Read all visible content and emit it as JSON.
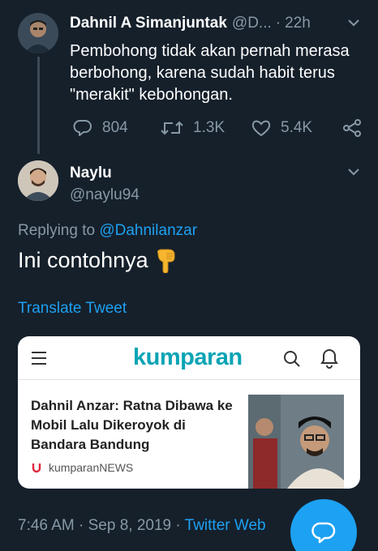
{
  "tweet1": {
    "name": "Dahnil A Simanjuntak",
    "handle": "@D...",
    "separator": "·",
    "time": "22h",
    "text": "Pembohong tidak akan pernah merasa berbohong, karena sudah habit terus \"merakit\" kebohongan.",
    "reply_count": "804",
    "retweet_count": "1.3K",
    "like_count": "5.4K"
  },
  "tweet2": {
    "name": "Naylu",
    "handle": "@naylu94",
    "replying_prefix": "Replying to ",
    "replying_to": "@Dahnilanzar",
    "text": "Ini contohnya",
    "translate": "Translate Tweet"
  },
  "card": {
    "logo": "kumparan",
    "headline": "Dahnil Anzar: Ratna Dibawa ke Mobil Lalu Dikeroyok di Bandara Bandung",
    "source": "kumparanNEWS"
  },
  "footer": {
    "time": "7:46 AM",
    "sep1": " · ",
    "date": "Sep 8, 2019",
    "sep2": " · ",
    "client": "Twitter Web"
  },
  "colors": {
    "background": "#15202b",
    "accent": "#1da1f2",
    "muted": "#8899a6",
    "brand": "#0aa4b5"
  },
  "icons": [
    "chevron-down-icon",
    "reply-icon",
    "retweet-icon",
    "like-icon",
    "share-icon",
    "pointing-down-emoji",
    "menu-icon",
    "search-icon",
    "bell-icon",
    "compose-reply-icon"
  ]
}
